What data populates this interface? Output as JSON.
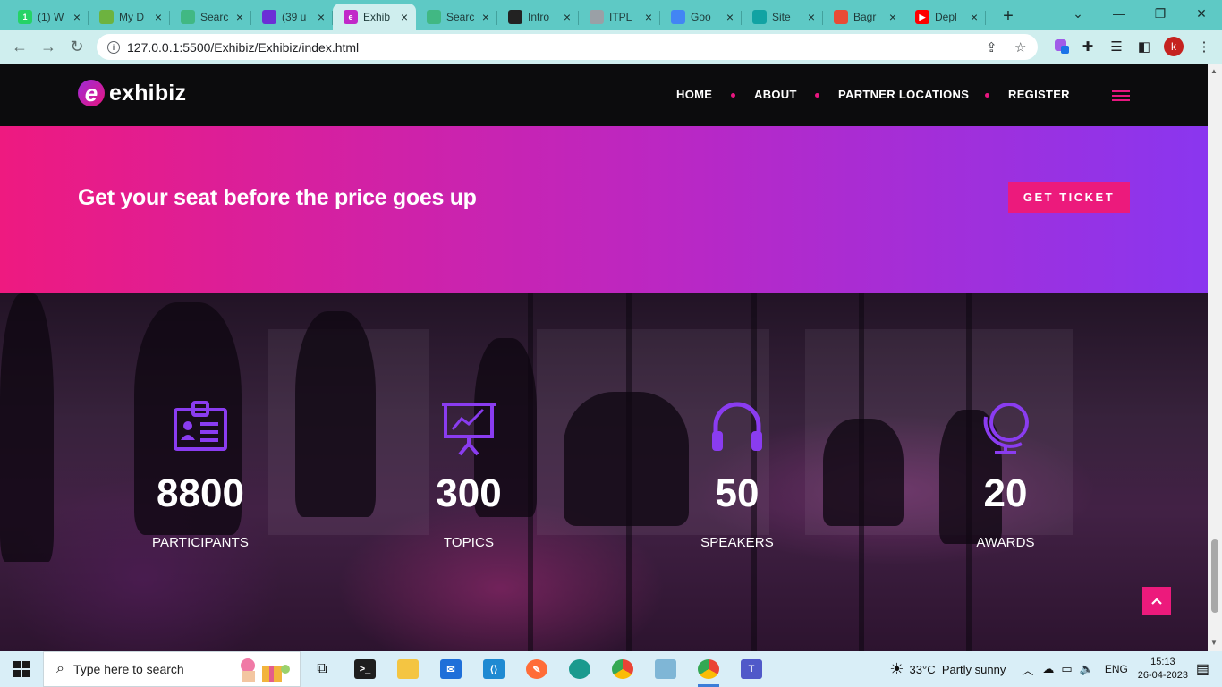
{
  "browser": {
    "tabs": [
      {
        "label": "(1) W",
        "icon": "whatsapp-icon",
        "color": "#25d366",
        "glyph": "1"
      },
      {
        "label": "My D",
        "icon": "leaf-icon",
        "color": "#6db33f",
        "glyph": ""
      },
      {
        "label": "Searc",
        "icon": "vue-icon",
        "color": "#41b883",
        "glyph": ""
      },
      {
        "label": "(39 u",
        "icon": "mail-icon",
        "color": "#6b2fd6",
        "glyph": ""
      },
      {
        "label": "Exhib",
        "icon": "exhibiz-icon",
        "color": "#c129c9",
        "glyph": "e",
        "active": true
      },
      {
        "label": "Searc",
        "icon": "vue-icon",
        "color": "#41b883",
        "glyph": ""
      },
      {
        "label": "Intro",
        "icon": "chatgpt-icon",
        "color": "#222222",
        "glyph": ""
      },
      {
        "label": "ITPL",
        "icon": "chatgpt-icon",
        "color": "#9aa0a6",
        "glyph": ""
      },
      {
        "label": "Goo",
        "icon": "flag-icon",
        "color": "#4285f4",
        "glyph": ""
      },
      {
        "label": "Site",
        "icon": "diamond-icon",
        "color": "#11a3a3",
        "glyph": ""
      },
      {
        "label": "Bagr",
        "icon": "bagrii-icon",
        "color": "#e94b35",
        "glyph": ""
      },
      {
        "label": "Depl",
        "icon": "youtube-icon",
        "color": "#ff0000",
        "glyph": "▶"
      }
    ],
    "url": "127.0.0.1:5500/Exhibiz/Exhibiz/index.html",
    "profile_initial": "k"
  },
  "site": {
    "logo_mark": "e",
    "logo_text": "exhibiz",
    "nav": [
      "HOME",
      "ABOUT",
      "PARTNER LOCATIONS",
      "REGISTER"
    ],
    "cta_title": "Get your seat before the price goes up",
    "cta_button": "GET TICKET",
    "stats": [
      {
        "number": "8800",
        "label": "PARTICIPANTS",
        "icon": "id-card-icon"
      },
      {
        "number": "300",
        "label": "TOPICS",
        "icon": "presentation-icon"
      },
      {
        "number": "50",
        "label": "SPEAKERS",
        "icon": "headphones-icon"
      },
      {
        "number": "20",
        "label": "AWARDS",
        "icon": "globe-icon"
      }
    ],
    "accent": "#ec1a7c",
    "icon_color": "#8a3cf0"
  },
  "taskbar": {
    "search_placeholder": "Type here to search",
    "weather": "33°C  Partly sunny",
    "language": "ENG",
    "time": "15:13",
    "date": "26-04-2023"
  }
}
